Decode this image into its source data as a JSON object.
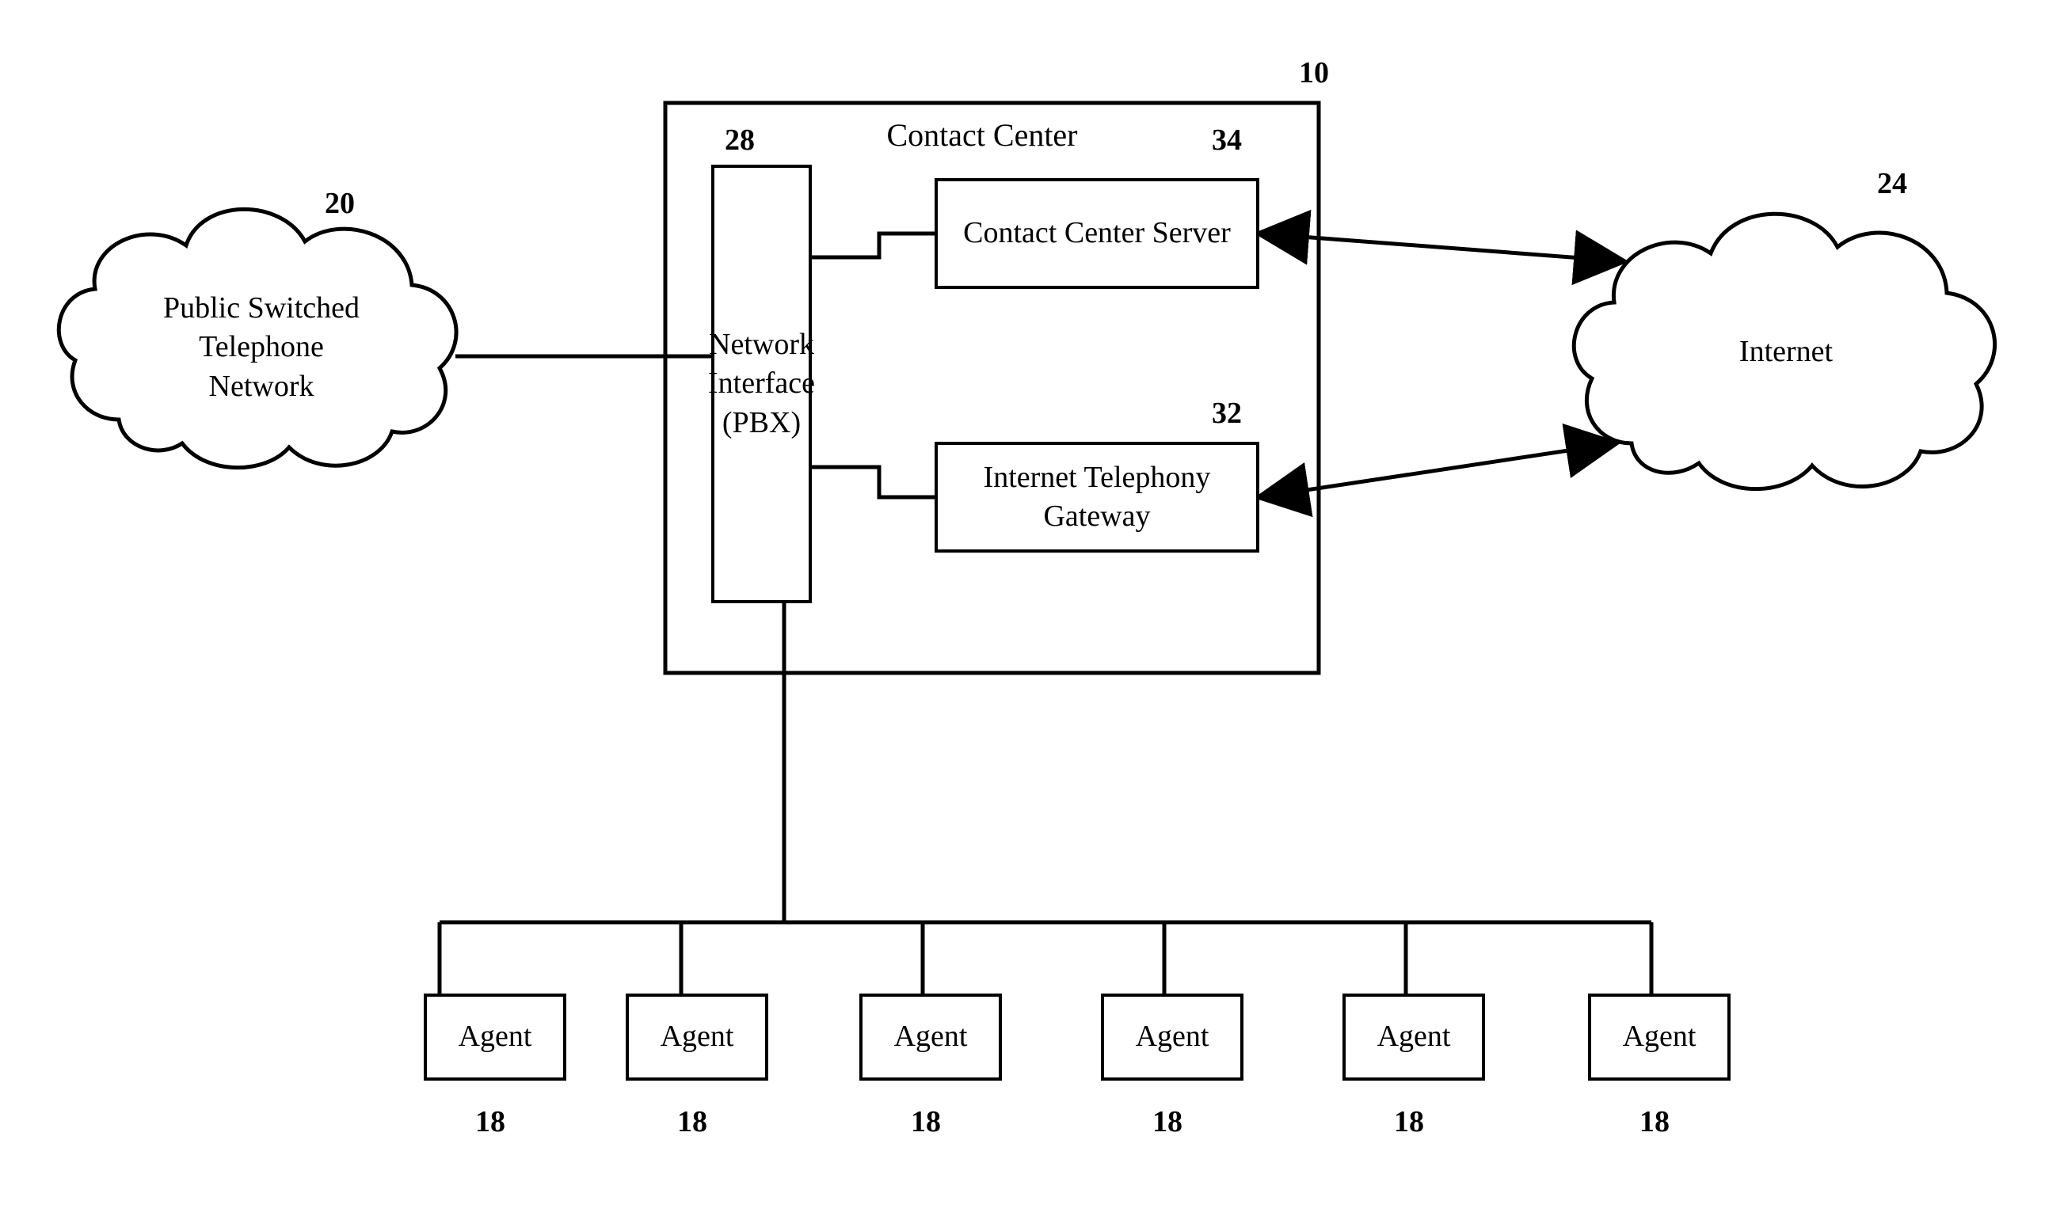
{
  "nodes": {
    "pstn": {
      "label": "Public Switched\nTelephone\nNetwork",
      "ref": "20"
    },
    "internet": {
      "label": "Internet",
      "ref": "24"
    },
    "contactCenter": {
      "title": "Contact Center",
      "ref": "10"
    },
    "pbx": {
      "label": "Network\nInterface\n(PBX)",
      "ref": "28"
    },
    "server": {
      "label": "Contact Center\nServer",
      "ref": "34"
    },
    "gateway": {
      "label": "Internet Telephony\nGateway",
      "ref": "32"
    }
  },
  "agents": {
    "label": "Agent",
    "ref": "18",
    "count": 6
  }
}
